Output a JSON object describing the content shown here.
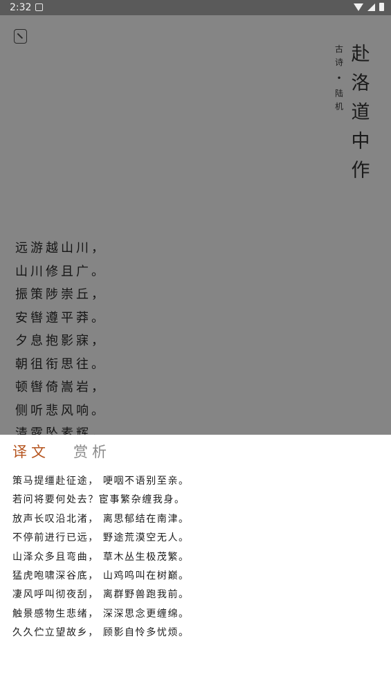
{
  "status_bar": {
    "time": "2:32"
  },
  "poem": {
    "title": "赴洛道中作",
    "category": "古诗",
    "separator": "•",
    "author": "陆机",
    "lines": [
      "远游越山川，",
      "山川修且广。",
      "振策陟崇丘，",
      "安辔遵平莽。",
      "夕息抱影寐，",
      "朝徂衔思往。",
      "顿辔倚嵩岩，",
      "侧听悲风响。",
      "清露坠素辉，"
    ]
  },
  "tabs": [
    {
      "label": "译文",
      "active": true
    },
    {
      "label": "赏析",
      "active": false
    }
  ],
  "translation": {
    "lines": [
      "策马提缰赴征途，  哽咽不语别至亲。",
      "若问将要何处去？宦事繁杂缠我身。",
      "放声长叹沿北渚，  离思郁结在南津。",
      "不停前进行已远，  野途荒漠空无人。",
      "山泽众多且弯曲，  草木丛生极茂繁。",
      "猛虎咆啸深谷底，  山鸡鸣叫在树巅。",
      "凄风呼叫彻夜刮，  离群野兽跑我前。",
      "触景感物生悲绪，  深深思念更缠绵。",
      "久久伫立望故乡，  顾影自怜多忧烦。"
    ]
  },
  "colors": {
    "accent": "#b5541e",
    "scrim": "#858585",
    "status_bar": "#5a5a5a"
  },
  "icons": {
    "menu": "menu-icon",
    "wifi": "wifi-icon",
    "signal": "signal-icon",
    "battery": "battery-icon",
    "notification": "notification-icon"
  }
}
